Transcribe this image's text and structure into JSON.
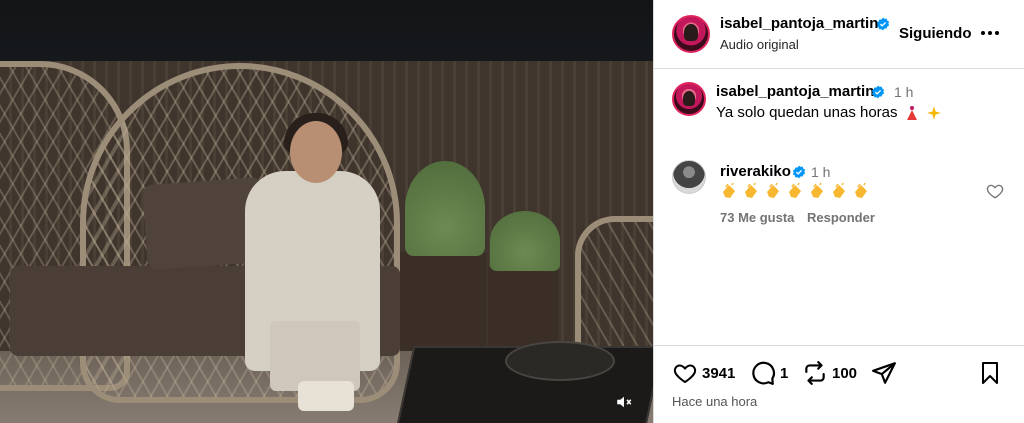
{
  "post": {
    "author": "isabel_pantoja_martin",
    "audio": "Audio original",
    "follow_label": "Siguiendo",
    "caption_user": "isabel_pantoja_martin",
    "caption_time": "1 h",
    "caption_text": "Ya solo quedan unas horas",
    "caption_emojis": [
      "dancer-emoji",
      "sparkles-emoji"
    ],
    "time_ago": "Hace una hora"
  },
  "comments": [
    {
      "user": "riverakiko",
      "time": "1 h",
      "emojis": [
        "clap-emoji",
        "clap-emoji",
        "clap-emoji",
        "clap-emoji",
        "clap-emoji",
        "clap-emoji",
        "clap-emoji"
      ],
      "likes": "73 Me gusta",
      "reply_label": "Responder"
    }
  ],
  "actions": {
    "likes": "3941",
    "comments": "1",
    "reposts": "100"
  },
  "colors": {
    "verified": "#0095f6",
    "secondary_text": "#737373",
    "border": "#dbdbdb"
  },
  "icons": {
    "more": "more-dots-icon",
    "like": "heart-icon",
    "comment": "comment-bubble-icon",
    "repost": "repost-icon",
    "share": "send-icon",
    "save": "bookmark-icon",
    "mute": "muted-speaker-icon"
  }
}
